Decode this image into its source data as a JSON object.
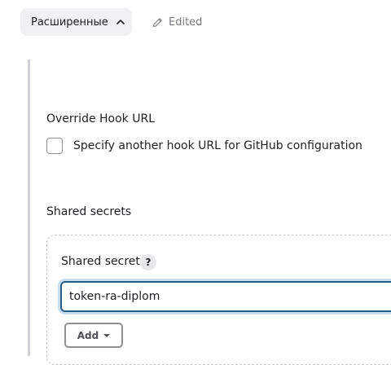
{
  "advanced": {
    "label": "Расширенные",
    "state_label": "Edited"
  },
  "override_hook": {
    "title": "Override Hook URL",
    "checkbox_label": "Specify another hook URL for GitHub configuration",
    "checked": false
  },
  "shared_secrets": {
    "title": "Shared secrets",
    "item_label": "Shared secret",
    "help_label": "?",
    "secret_value": "token-ra-diplom",
    "add_label": "Add"
  }
}
